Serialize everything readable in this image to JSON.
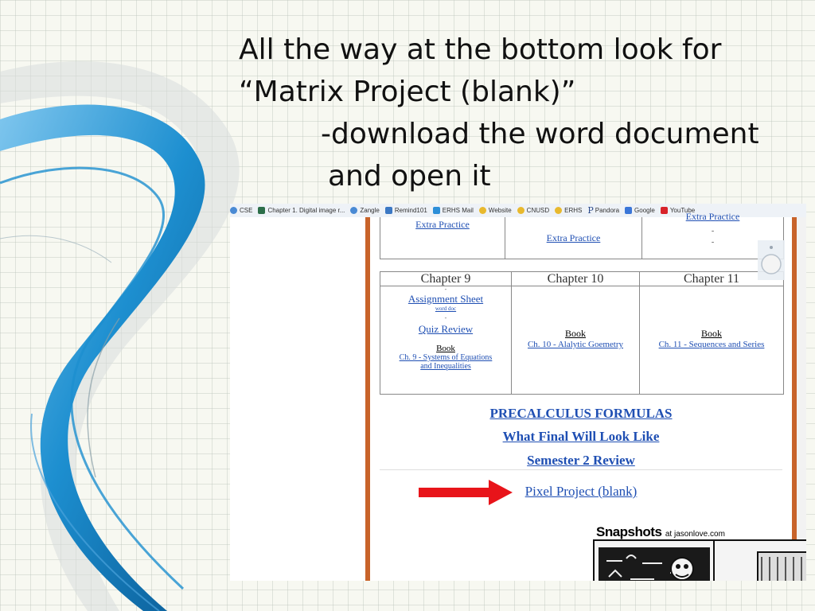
{
  "slide": {
    "line1": "All the way at the bottom look for",
    "line2": "“Matrix Project (blank)”",
    "line3": "-download the word document",
    "line4": "and open it"
  },
  "bookmarks": [
    {
      "label": "CSE",
      "color": "#4a8ad4",
      "icon": "globe-icon"
    },
    {
      "label": "Chapter 1. Digital image r...",
      "color": "#2c6e49",
      "icon": "page-icon"
    },
    {
      "label": "Zangle",
      "color": "#4a8ad4",
      "icon": "globe-icon"
    },
    {
      "label": "Remind101",
      "color": "#3b78c4",
      "icon": "page-icon"
    },
    {
      "label": "ERHS Mail",
      "color": "#2d8fd8",
      "icon": "mail-icon"
    },
    {
      "label": "Website",
      "color": "#e8b92e",
      "icon": "folder-icon"
    },
    {
      "label": "CNUSD",
      "color": "#e8b92e",
      "icon": "folder-icon"
    },
    {
      "label": "ERHS",
      "color": "#e8b92e",
      "icon": "folder-icon"
    },
    {
      "label": "Pandora",
      "color": "#2b4a8a",
      "icon": "pandora-icon"
    },
    {
      "label": "Google",
      "color": "#3a76d8",
      "icon": "google-icon"
    },
    {
      "label": "YouTube",
      "color": "#d8232a",
      "icon": "youtube-icon"
    }
  ],
  "top_table": {
    "col1": "Extra Practice",
    "col2": "Extra Practice",
    "col3_faded": "Extra Practice",
    "col3_dash1": "-",
    "col3_dash2": "-"
  },
  "table": {
    "headers": [
      "Chapter 9",
      "Chapter 10",
      "Chapter 11"
    ],
    "ch9": {
      "assignment": "Assignment Sheet",
      "word_doc": "word doc",
      "dash1": "-",
      "quiz": "Quiz Review",
      "dash2": "-",
      "book": "Book",
      "book_link_1": "Ch. 9 - Systems of Equations",
      "book_link_2": "and Inequalities"
    },
    "ch10": {
      "book": "Book",
      "book_link": "Ch. 10 - Alalytic Goemetry"
    },
    "ch11": {
      "book": "Book",
      "book_link": "Ch. 11 - Sequences and Series"
    }
  },
  "links": {
    "formulas": "PRECALCULUS FORMULAS",
    "final": "What Final Will Look Like",
    "semester": "Semester 2 Review",
    "pixel": "Pixel Project (blank)"
  },
  "snapshots": {
    "title": "Snapshots",
    "site": "at jasonlove.com"
  },
  "colors": {
    "accent_orange": "#c8632a",
    "link_blue": "#1f4fb3",
    "arrow_red": "#e8141a"
  }
}
